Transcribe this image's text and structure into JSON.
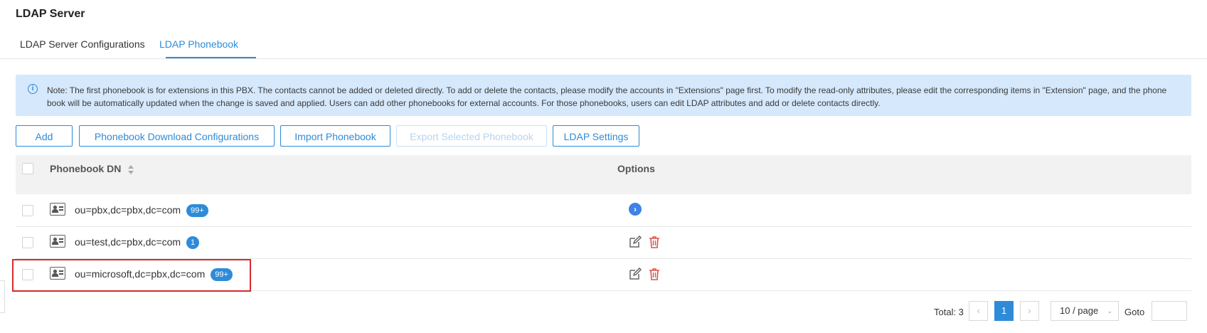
{
  "page": {
    "title": "LDAP Server"
  },
  "tabs": [
    {
      "label": "LDAP Server Configurations",
      "active": false
    },
    {
      "label": "LDAP Phonebook",
      "active": true
    }
  ],
  "note": {
    "icon": "info-icon",
    "text": "Note: The first phonebook is for extensions in this PBX. The contacts cannot be added or deleted directly. To add or delete the contacts, please modify the accounts in \"Extensions\" page first. To modify the read-only attributes, please edit the corresponding items in \"Extension\" page, and the phone book will be automatically updated when the change is saved and applied. Users can add other phonebooks for external accounts. For those phonebooks, users can edit LDAP attributes and add or delete contacts directly."
  },
  "toolbar": {
    "add": "Add",
    "download_config": "Phonebook Download Configurations",
    "import": "Import Phonebook",
    "export": "Export Selected Phonebook",
    "ldap_settings": "LDAP Settings"
  },
  "table": {
    "headers": {
      "dn": "Phonebook DN",
      "options": "Options"
    },
    "rows": [
      {
        "dn": "ou=pbx,dc=pbx,dc=com",
        "badge": "99+",
        "options": "arrow"
      },
      {
        "dn": "ou=test,dc=pbx,dc=com",
        "badge": "1",
        "options": "edit-delete"
      },
      {
        "dn": "ou=microsoft,dc=pbx,dc=com",
        "badge": "99+",
        "options": "edit-delete",
        "highlighted": true
      }
    ]
  },
  "pagination": {
    "total": "Total: 3",
    "prev": "‹",
    "current": "1",
    "next": "›",
    "page_size": "10 / page",
    "goto_label": "Goto",
    "goto_value": ""
  },
  "colors": {
    "accent": "#2e8bd8",
    "highlight": "#d42b2b",
    "delete": "#d9534f"
  }
}
